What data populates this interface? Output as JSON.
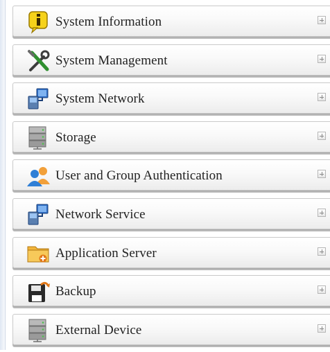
{
  "menu": {
    "items": [
      {
        "label": "System Information",
        "icon": "info-icon"
      },
      {
        "label": "System Management",
        "icon": "tools-icon"
      },
      {
        "label": "System Network",
        "icon": "network-icon"
      },
      {
        "label": "Storage",
        "icon": "storage-icon"
      },
      {
        "label": "User and Group Authentication",
        "icon": "users-icon"
      },
      {
        "label": "Network Service",
        "icon": "network-icon"
      },
      {
        "label": "Application Server",
        "icon": "folder-add-icon"
      },
      {
        "label": "Backup",
        "icon": "backup-icon"
      },
      {
        "label": "External Device",
        "icon": "storage-icon"
      }
    ]
  },
  "colors": {
    "item_text": "#222222",
    "item_border": "#c9c9c9",
    "left_strip": "#dfe7f3"
  }
}
